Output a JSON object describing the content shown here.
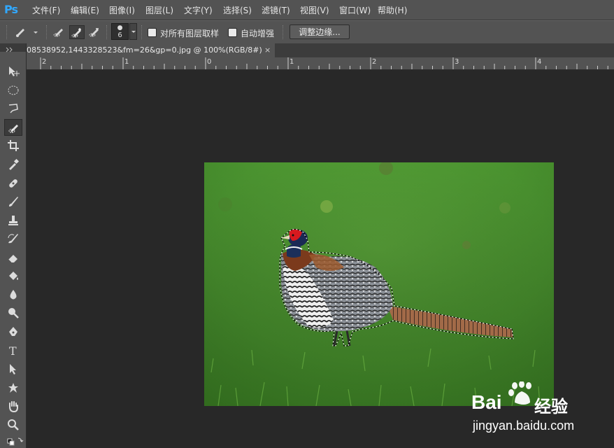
{
  "app": {
    "logo": "Ps"
  },
  "menu": [
    "文件(F)",
    "编辑(E)",
    "图像(I)",
    "图层(L)",
    "文字(Y)",
    "选择(S)",
    "滤镜(T)",
    "视图(V)",
    "窗口(W)",
    "帮助(H)"
  ],
  "options": {
    "brush_size": "6",
    "sample_all_layers": "对所有图层取样",
    "auto_enhance": "自动增强",
    "refine_edge": "调整边缘..."
  },
  "document": {
    "tab_title": "08538952,1443328523&fm=26&gp=0.jpg @ 100%(RGB/8#)",
    "close": "×"
  },
  "ruler": {
    "labels": [
      "2",
      "1",
      "0",
      "1",
      "2",
      "3",
      "4"
    ]
  },
  "tools": [
    "move-icon",
    "elliptical-marquee-icon",
    "polygonal-lasso-icon",
    "quick-selection-icon",
    "crop-icon",
    "eyedropper-icon",
    "spot-healing-icon",
    "brush-icon",
    "clone-stamp-icon",
    "history-brush-icon",
    "eraser-icon",
    "paint-bucket-icon",
    "blur-icon",
    "dodge-icon",
    "pen-icon",
    "type-icon",
    "path-selection-icon",
    "custom-shape-icon",
    "hand-icon",
    "zoom-icon",
    "default-colors-icon"
  ],
  "watermark": {
    "brand_a": "Bai",
    "brand_b": "经验",
    "url": "jingyan.baidu.com"
  },
  "colors": {
    "ui": "#535353",
    "canvas": "#282828",
    "accent": "#31a8ff"
  }
}
